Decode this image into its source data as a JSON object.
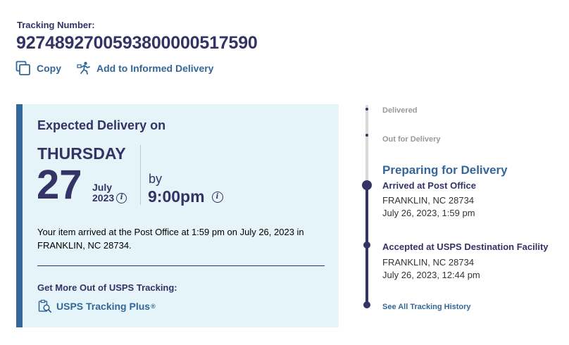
{
  "tracking": {
    "label": "Tracking Number:",
    "number": "9274892700593800000517590"
  },
  "actions": {
    "copy": "Copy",
    "informed_delivery": "Add to Informed Delivery"
  },
  "expected": {
    "title": "Expected Delivery on",
    "day": "THURSDAY",
    "date": "27",
    "month": "July",
    "year": "2023",
    "by": "by",
    "time": "9:00pm"
  },
  "status_text": "Your item arrived at the Post Office at 1:59 pm on July 26, 2023 in FRANKLIN, NC 28734.",
  "more": {
    "title": "Get More Out of USPS Tracking:",
    "link": "USPS Tracking Plus",
    "link_mark": "®"
  },
  "timeline": {
    "delivered": "Delivered",
    "out_for_delivery": "Out for Delivery",
    "current_heading": "Preparing for Delivery",
    "events": [
      {
        "title": "Arrived at Post Office",
        "location": "FRANKLIN, NC 28734",
        "datetime": "July 26, 2023, 1:59 pm"
      },
      {
        "title": "Accepted at USPS Destination Facility",
        "location": "FRANKLIN, NC 28734",
        "datetime": "July 26, 2023, 12:44 pm"
      }
    ],
    "see_all": "See All Tracking History"
  },
  "colors": {
    "navy": "#333366",
    "link_blue": "#336699",
    "card_bg": "#e5f4f8",
    "inactive_gray": "#999999"
  },
  "icons": [
    "copy-icon",
    "informed-delivery-icon",
    "info-icon",
    "tracking-plus-icon"
  ]
}
